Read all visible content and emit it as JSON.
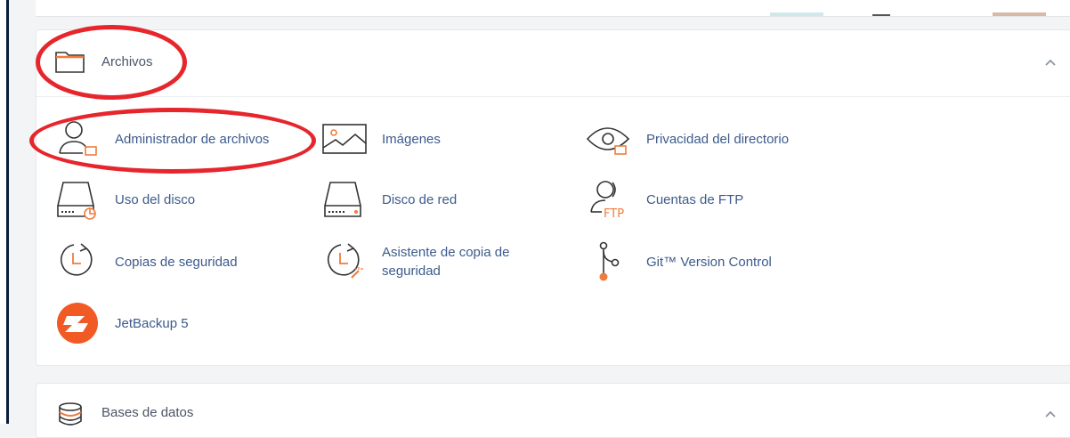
{
  "sections": {
    "files": {
      "title": "Archivos",
      "items": [
        {
          "label": "Administrador de archivos",
          "icon": "file-manager-icon"
        },
        {
          "label": "Imágenes",
          "icon": "images-icon"
        },
        {
          "label": "Privacidad del directorio",
          "icon": "directory-privacy-icon"
        },
        {
          "label": "Uso del disco",
          "icon": "disk-usage-icon"
        },
        {
          "label": "Disco de red",
          "icon": "network-disk-icon"
        },
        {
          "label": "Cuentas de FTP",
          "icon": "ftp-accounts-icon"
        },
        {
          "label": "Copias de seguridad",
          "icon": "backup-icon"
        },
        {
          "label": "Asistente de copia de seguridad",
          "icon": "backup-wizard-icon"
        },
        {
          "label": "Git™ Version Control",
          "icon": "git-icon"
        },
        {
          "label": "JetBackup 5",
          "icon": "jetbackup-icon"
        }
      ]
    },
    "databases": {
      "title": "Bases de datos"
    }
  },
  "icons": {
    "section_collapse": "chevron-up-icon",
    "files_section": "folder-icon",
    "databases_section": "database-icon"
  },
  "colors": {
    "accent_orange": "#f07b3f",
    "link_blue": "#3c5b8c",
    "annotation_red": "#e6262c",
    "jetbackup_orange": "#f15a24"
  }
}
